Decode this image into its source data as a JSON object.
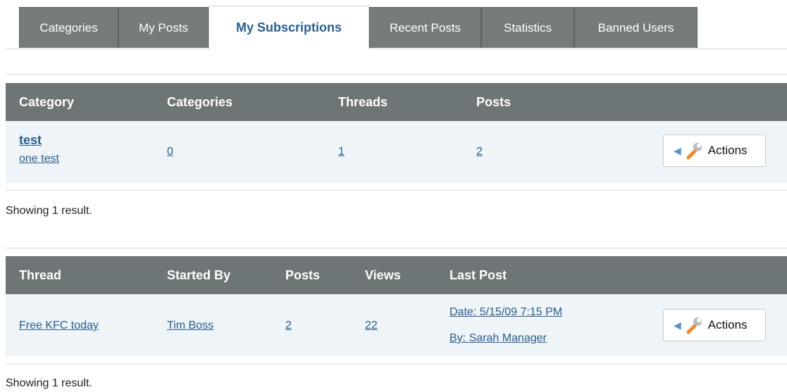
{
  "tabs": [
    {
      "label": "Categories"
    },
    {
      "label": "My Posts"
    },
    {
      "label": "My Subscriptions"
    },
    {
      "label": "Recent Posts"
    },
    {
      "label": "Statistics"
    },
    {
      "label": "Banned Users"
    }
  ],
  "categories_table": {
    "headers": [
      "Category",
      "Categories",
      "Threads",
      "Posts"
    ],
    "row": {
      "name": "test",
      "description": "one test",
      "categories": "0",
      "threads": "1",
      "posts": "2",
      "actions_label": "Actions"
    },
    "status": "Showing 1 result."
  },
  "threads_table": {
    "headers": [
      "Thread",
      "Started By",
      "Posts",
      "Views",
      "Last Post"
    ],
    "row": {
      "thread": "Free KFC today",
      "started_by": "Tim Boss",
      "posts": "2",
      "views": "22",
      "last_post_date": "Date: 5/15/09 7:15 PM",
      "last_post_by": "By: Sarah Manager",
      "actions_label": "Actions"
    },
    "status": "Showing 1 result."
  },
  "icons": {
    "actions_chevron": "chevron-left-icon",
    "actions_wrench": "wrench-icon"
  },
  "colors": {
    "tab_bg": "#767b7c",
    "active_tab_text": "#2b5f8f",
    "header_bg": "#6e7576",
    "row_bg": "#eef4f7",
    "link": "#2a5d8d"
  }
}
